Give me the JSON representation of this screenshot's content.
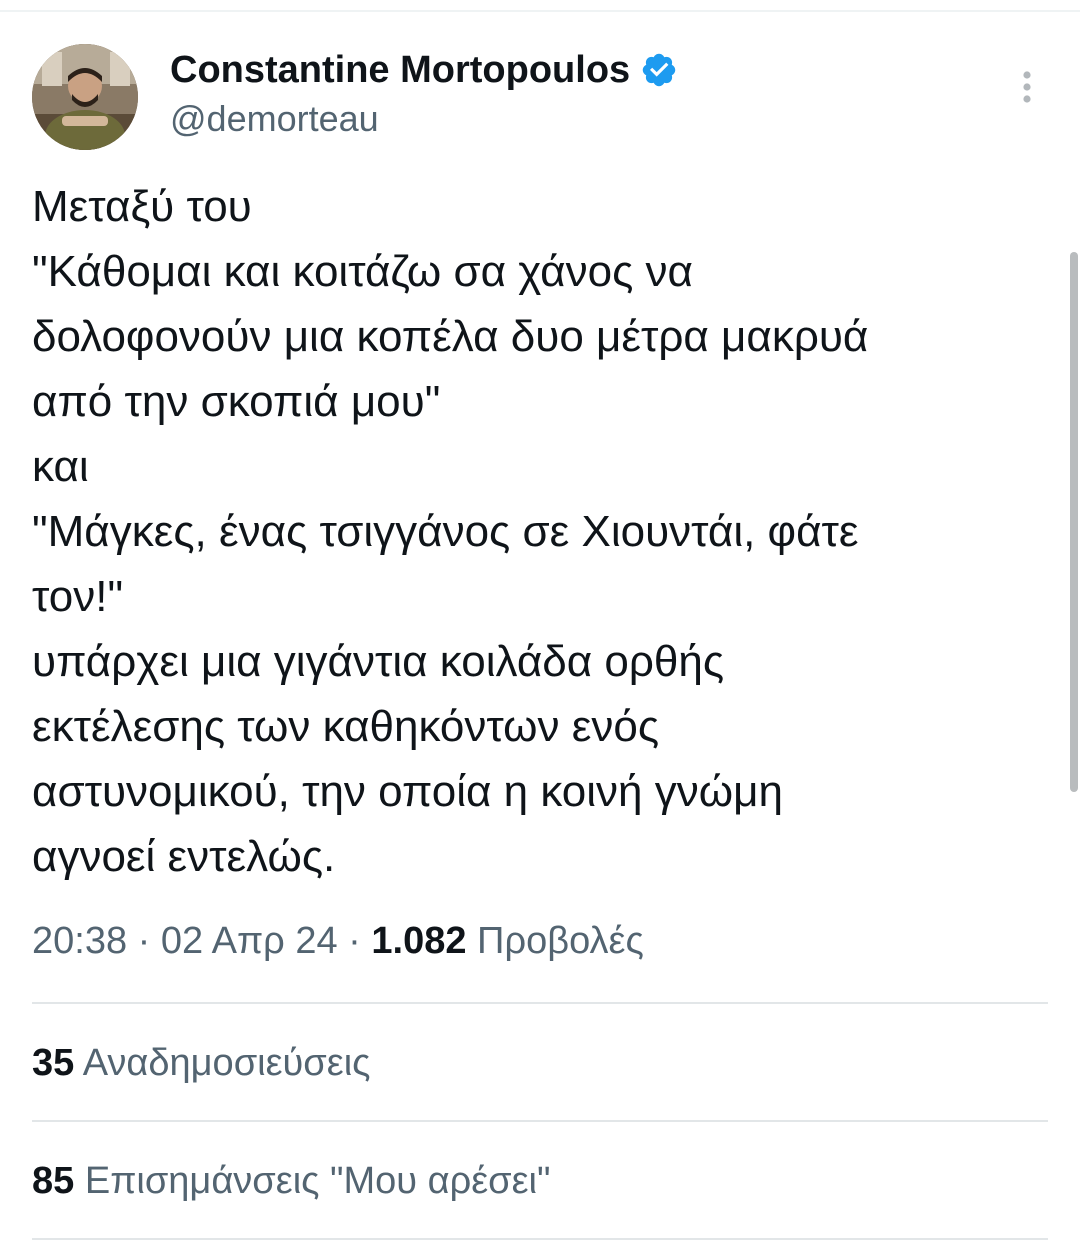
{
  "author": {
    "name": "Constantine Mortopoulos",
    "handle": "@demorteau",
    "verified": true,
    "verified_color": "#1d9bf0"
  },
  "tweet": {
    "lines": [
      "Μεταξύ του",
      "\"Κάθομαι και κοιτάζω σα χάνος να",
      "δολοφονούν μια κοπέλα δυο μέτρα μακρυά",
      "από την σκοπιά μου\"",
      "και",
      "\"Μάγκες, ένας τσιγγάνος σε Χιουντάι, φάτε",
      "τον!\"",
      "υπάρχει μια γιγάντια κοιλάδα ορθής",
      "εκτέλεσης των καθηκόντων ενός",
      "αστυνομικού, την οποία η κοινή γνώμη",
      "αγνοεί εντελώς."
    ]
  },
  "meta": {
    "time": "20:38",
    "separator": " · ",
    "date": "02 Απρ 24",
    "views_count": "1.082",
    "views_label": "Προβολές"
  },
  "stats": {
    "reposts_count": "35",
    "reposts_label": "Αναδημοσιεύσεις",
    "likes_count": "85",
    "likes_label": "Επισημάνσεις \"Μου αρέσει\""
  },
  "icons": {
    "more": "more-vertical-icon",
    "verified": "verified-badge-icon"
  },
  "colors": {
    "text_primary": "#0f1419",
    "text_secondary": "#536471",
    "divider": "#e2e6e8"
  }
}
